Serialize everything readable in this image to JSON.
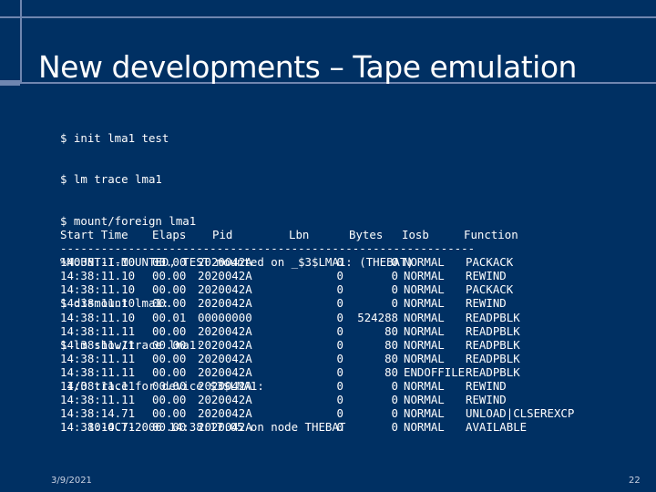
{
  "slide": {
    "title": "New developments – Tape emulation",
    "date": "3/9/2021",
    "page_number": "22"
  },
  "console": {
    "lines": [
      "$ init lma1 test",
      "$ lm trace lma1",
      "$ mount/foreign lma1",
      "%MOUNT-I-MOUNTED, TEST mounted on _$3$LMA1: (THEBAT)",
      "$ dismount lma1:",
      "$ lm show/trace lma1:",
      " I/O trace for device $3$LMA1:",
      "    10-OCT-2006 14:38:17.05 on node THEBAT"
    ]
  },
  "trace_table": {
    "headers": {
      "time": "Start Time",
      "elaps": "Elaps",
      "pid": "Pid",
      "lbn": "Lbn",
      "bytes": "Bytes",
      "iosb": "Iosb",
      "function": "Function"
    },
    "divider": "-------------------------------------------------------------",
    "rows": [
      {
        "time": "14:38:11.10",
        "elaps": "00.00",
        "pid": "2020042A",
        "lbn": "0",
        "bytes": "0",
        "iosb": "NORMAL",
        "function": "PACKACK"
      },
      {
        "time": "14:38:11.10",
        "elaps": "00.00",
        "pid": "2020042A",
        "lbn": "0",
        "bytes": "0",
        "iosb": "NORMAL",
        "function": "REWIND"
      },
      {
        "time": "14:38:11.10",
        "elaps": "00.00",
        "pid": "2020042A",
        "lbn": "0",
        "bytes": "0",
        "iosb": "NORMAL",
        "function": "PACKACK"
      },
      {
        "time": "14:38:11.10",
        "elaps": "00.00",
        "pid": "2020042A",
        "lbn": "0",
        "bytes": "0",
        "iosb": "NORMAL",
        "function": "REWIND"
      },
      {
        "time": "14:38:11.10",
        "elaps": "00.01",
        "pid": "00000000",
        "lbn": "0",
        "bytes": "524288",
        "iosb": "NORMAL",
        "function": "READPBLK"
      },
      {
        "time": "14:38:11.11",
        "elaps": "00.00",
        "pid": "2020042A",
        "lbn": "0",
        "bytes": "80",
        "iosb": "NORMAL",
        "function": "READPBLK"
      },
      {
        "time": "14:38:11.11",
        "elaps": "00.00",
        "pid": "2020042A",
        "lbn": "0",
        "bytes": "80",
        "iosb": "NORMAL",
        "function": "READPBLK"
      },
      {
        "time": "14:38:11.11",
        "elaps": "00.00",
        "pid": "2020042A",
        "lbn": "0",
        "bytes": "80",
        "iosb": "NORMAL",
        "function": "READPBLK"
      },
      {
        "time": "14:38:11.11",
        "elaps": "00.00",
        "pid": "2020042A",
        "lbn": "0",
        "bytes": "80",
        "iosb": "ENDOFFILE",
        "function": "READPBLK"
      },
      {
        "time": "14:38:11.11",
        "elaps": "00.00",
        "pid": "2020042A",
        "lbn": "0",
        "bytes": "0",
        "iosb": "NORMAL",
        "function": "REWIND"
      },
      {
        "time": "14:38:11.11",
        "elaps": "00.00",
        "pid": "2020042A",
        "lbn": "0",
        "bytes": "0",
        "iosb": "NORMAL",
        "function": "REWIND"
      },
      {
        "time": "14:38:14.71",
        "elaps": "00.00",
        "pid": "2020042A",
        "lbn": "0",
        "bytes": "0",
        "iosb": "NORMAL",
        "function": "UNLOAD|CLSEREXCP"
      },
      {
        "time": "14:38:14.71",
        "elaps": "00.00",
        "pid": "2020042A",
        "lbn": "0",
        "bytes": "0",
        "iosb": "NORMAL",
        "function": "AVAILABLE"
      }
    ]
  },
  "colors": {
    "background": "#003063",
    "rule": "#6f86b0",
    "text": "#ffffff"
  }
}
